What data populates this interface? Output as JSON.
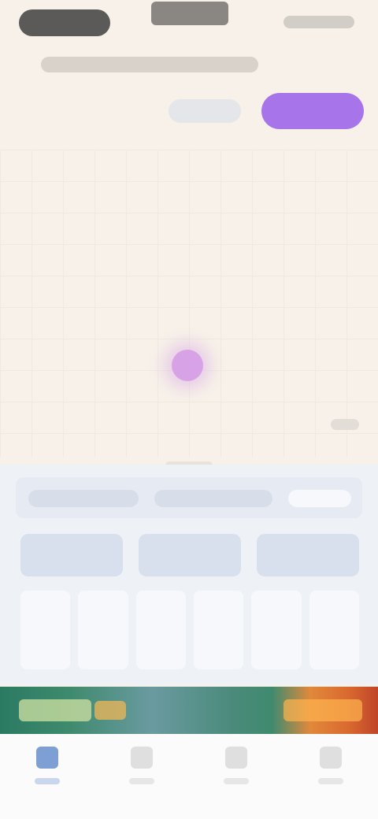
{
  "colors": {
    "background": "#f7f1e9",
    "primary_button": "#a774ea",
    "marker": "#d8a3e6",
    "panel_background": "#eef2f7",
    "tab_active": "#7d9fd3"
  },
  "top_actions": {
    "secondary_button_label": "",
    "primary_button_label": ""
  },
  "banner": {
    "text": ""
  },
  "tabs": [
    {
      "label": "",
      "icon": "home-icon",
      "active": true
    },
    {
      "label": "",
      "icon": "list-icon",
      "active": false
    },
    {
      "label": "",
      "icon": "chart-icon",
      "active": false
    },
    {
      "label": "",
      "icon": "profile-icon",
      "active": false
    }
  ]
}
